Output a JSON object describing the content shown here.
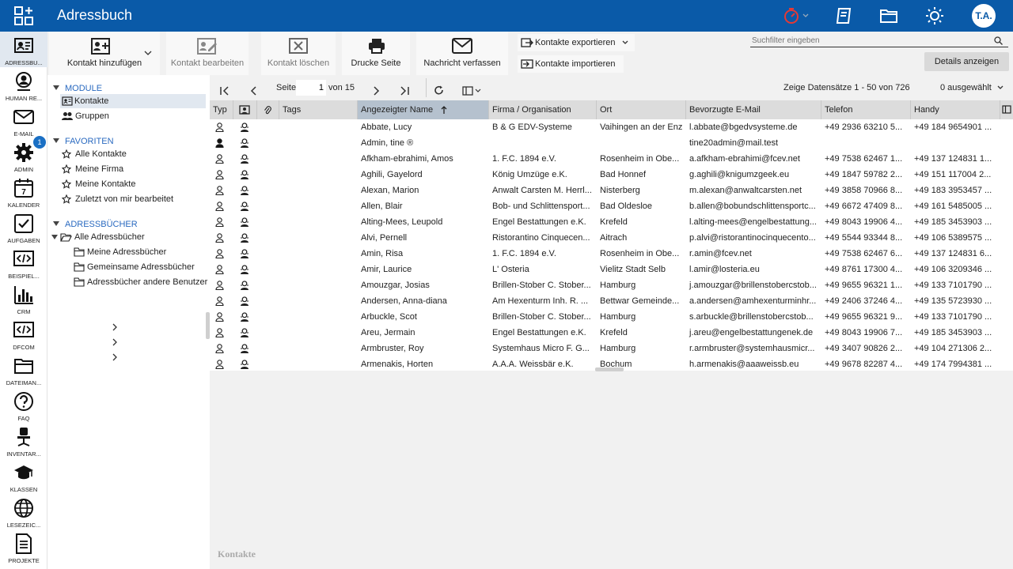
{
  "header": {
    "title": "Adressbuch",
    "user_initials": "T.A."
  },
  "sidebar": {
    "items": [
      {
        "label": "ADRESSBU...",
        "icon": "addressbook-icon",
        "active": true
      },
      {
        "label": "HUMAN RE...",
        "icon": "human-resources-icon"
      },
      {
        "label": "E-MAIL",
        "icon": "mail-icon",
        "badge": "1"
      },
      {
        "label": "ADMIN",
        "icon": "gear-icon"
      },
      {
        "label": "KALENDER",
        "icon": "calendar-icon",
        "day": "7"
      },
      {
        "label": "AUFGABEN",
        "icon": "tasks-icon"
      },
      {
        "label": "BEISPIEL...",
        "icon": "code-icon"
      },
      {
        "label": "CRM",
        "icon": "bar-chart-icon"
      },
      {
        "label": "DFCOM",
        "icon": "code-icon"
      },
      {
        "label": "DATEIMAN...",
        "icon": "folder-icon"
      },
      {
        "label": "FAQ",
        "icon": "question-icon"
      },
      {
        "label": "INVENTAR...",
        "icon": "chair-icon"
      },
      {
        "label": "KLASSEN",
        "icon": "graduation-cap-icon"
      },
      {
        "label": "LESEZEIC...",
        "icon": "globe-icon"
      },
      {
        "label": "PROJEKTE",
        "icon": "document-icon"
      }
    ]
  },
  "toolbar": {
    "add_contact": "Kontakt hinzufügen",
    "edit_contact": "Kontakt bearbeiten",
    "delete_contact": "Kontakt löschen",
    "print_page": "Drucke Seite",
    "compose_message": "Nachricht verfassen",
    "export_contacts": "Kontakte exportieren",
    "import_contacts": "Kontakte importieren",
    "search_placeholder": "Suchfilter eingeben",
    "details": "Details anzeigen"
  },
  "tree": {
    "modules_title": "MODULE",
    "modules": [
      "Kontakte",
      "Gruppen"
    ],
    "favorites_title": "FAVORITEN",
    "favorites": [
      "Alle Kontakte",
      "Meine Firma",
      "Meine Kontakte",
      "Zuletzt von mir bearbeitet"
    ],
    "addressbooks_title": "ADRESSBÜCHER",
    "all_addressbooks": "Alle Adressbücher",
    "addressbooks": [
      "Meine Adressbücher",
      "Gemeinsame Adressbücher",
      "Adressbücher andere Benutzer"
    ]
  },
  "pager": {
    "page_label": "Seite",
    "page_value": "1",
    "of_label": "von 15",
    "records": "Zeige Datensätze 1 - 50 von 726",
    "selected": "0 ausgewählt"
  },
  "columns": [
    "Typ",
    "",
    "",
    "Tags",
    "Angezeigter Name",
    "Firma / Organisation",
    "Ort",
    "Bevorzugte E-Mail",
    "Telefon",
    "Handy"
  ],
  "rows": [
    {
      "name": "Abbate, Lucy",
      "company": "B & G EDV-Systeme",
      "city": "Vaihingen an der Enz",
      "email": "l.abbate@bgedvsysteme.de",
      "phone": "+49 2936 63210 5...",
      "mobile": "+49 184 9654901 ..."
    },
    {
      "name": "Admin, tine ®",
      "company": "",
      "city": "",
      "email": "tine20admin@mail.test",
      "phone": "",
      "mobile": "",
      "user": true
    },
    {
      "name": "Afkham-ebrahimi, Amos",
      "company": "1. F.C. 1894 e.V.",
      "city": "Rosenheim in Obe...",
      "email": "a.afkham-ebrahimi@fcev.net",
      "phone": "+49 7538 62467 1...",
      "mobile": "+49 137 124831 1..."
    },
    {
      "name": "Aghili, Gayelord",
      "company": "König Umzüge e.K.",
      "city": "Bad Honnef",
      "email": "g.aghili@knigumzgeek.eu",
      "phone": "+49 1847 59782 2...",
      "mobile": "+49 151 117004 2..."
    },
    {
      "name": "Alexan, Marion",
      "company": "Anwalt Carsten M. Herrl...",
      "city": "Nisterberg",
      "email": "m.alexan@anwaltcarsten.net",
      "phone": "+49 3858 70966 8...",
      "mobile": "+49 183 3953457 ..."
    },
    {
      "name": "Allen, Blair",
      "company": "Bob- und Schlittensport...",
      "city": "Bad Oldesloe",
      "email": "b.allen@bobundschlittensportc...",
      "phone": "+49 6672 47409 8...",
      "mobile": "+49 161 5485005 ..."
    },
    {
      "name": "Alting-Mees, Leupold",
      "company": "Engel Bestattungen e.K.",
      "city": "Krefeld",
      "email": "l.alting-mees@engelbestattung...",
      "phone": "+49 8043 19906 4...",
      "mobile": "+49 185 3453903 ..."
    },
    {
      "name": "Alvi, Pernell",
      "company": "Ristorantino Cinquecen...",
      "city": "Aitrach",
      "email": "p.alvi@ristorantinocinquecento...",
      "phone": "+49 5544 93344 8...",
      "mobile": "+49 106 5389575 ..."
    },
    {
      "name": "Amin, Risa",
      "company": "1. F.C. 1894 e.V.",
      "city": "Rosenheim in Obe...",
      "email": "r.amin@fcev.net",
      "phone": "+49 7538 62467 6...",
      "mobile": "+49 137 124831 6..."
    },
    {
      "name": "Amir, Laurice",
      "company": "L' Osteria",
      "city": "Vielitz Stadt Selb",
      "email": "l.amir@losteria.eu",
      "phone": "+49 8761 17300 4...",
      "mobile": "+49 106 3209346 ..."
    },
    {
      "name": "Amouzgar, Josias",
      "company": "Brillen-Stober C. Stober...",
      "city": "Hamburg",
      "email": "j.amouzgar@brillenstobercstob...",
      "phone": "+49 9655 96321 1...",
      "mobile": "+49 133 7101790 ..."
    },
    {
      "name": "Andersen, Anna-diana",
      "company": "Am Hexenturm Inh. R. ...",
      "city": "Bettwar Gemeinde...",
      "email": "a.andersen@amhexenturminhr...",
      "phone": "+49 2406 37246 4...",
      "mobile": "+49 135 5723930 ..."
    },
    {
      "name": "Arbuckle, Scot",
      "company": "Brillen-Stober C. Stober...",
      "city": "Hamburg",
      "email": "s.arbuckle@brillenstobercstob...",
      "phone": "+49 9655 96321 9...",
      "mobile": "+49 133 7101790 ..."
    },
    {
      "name": "Areu, Jermain",
      "company": "Engel Bestattungen e.K.",
      "city": "Krefeld",
      "email": "j.areu@engelbestattungenek.de",
      "phone": "+49 8043 19906 7...",
      "mobile": "+49 185 3453903 ..."
    },
    {
      "name": "Armbruster, Roy",
      "company": "Systemhaus Micro F. G...",
      "city": "Hamburg",
      "email": "r.armbruster@systemhausmicr...",
      "phone": "+49 3407 90826 2...",
      "mobile": "+49 104 271306 2..."
    },
    {
      "name": "Armenakis, Horten",
      "company": "A.A.A. Weissbär e.K.",
      "city": "Bochum",
      "email": "h.armenakis@aaaweissb.eu",
      "phone": "+49 9678 82287 4...",
      "mobile": "+49 174 7994381 ..."
    }
  ],
  "footer": {
    "label": "Kontakte"
  }
}
